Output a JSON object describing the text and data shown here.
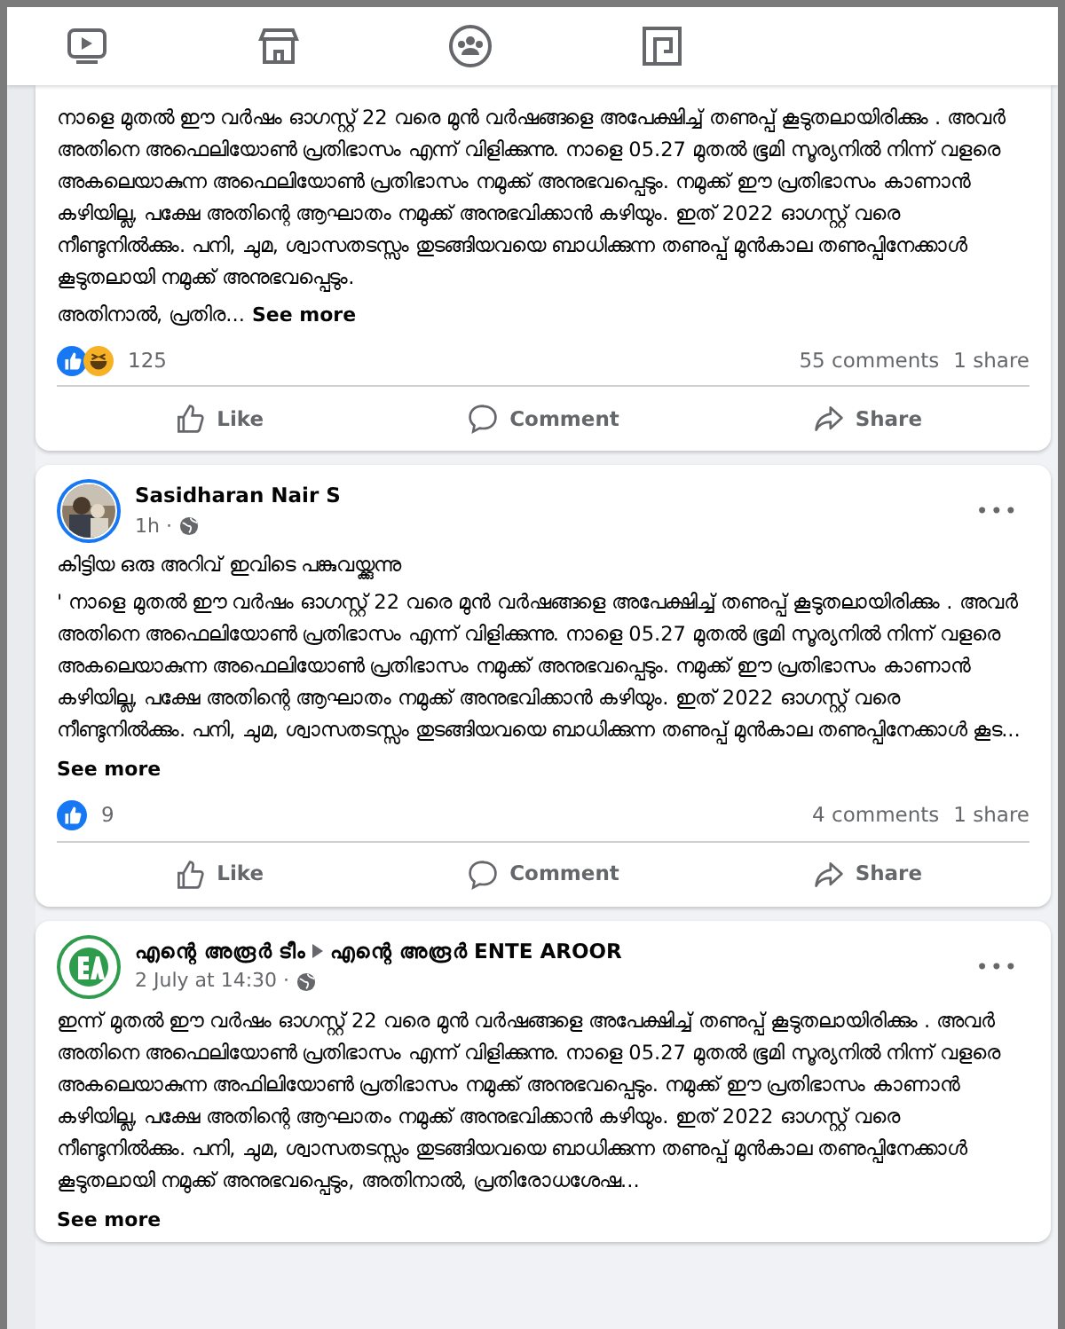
{
  "nav": [
    {
      "selected": false
    },
    {
      "selected": false
    },
    {
      "selected": false
    },
    {
      "selected": false
    }
  ],
  "posts": [
    {
      "paragraphs": [
        "നാളെ മുതൽ ഈ വർഷം ഓഗസ്റ്റ് 22 വരെ മുൻ വർഷങ്ങളെ അപേക്ഷിച്ച് തണുപ്പ് കൂടുതലായിരിക്കും .  അവർ അതിനെ അഫെലിയോൺ പ്രതിഭാസം എന്ന് വിളിക്കുന്നു.  നാളെ 05.27 മുതൽ ഭൂമി സൂര്യനിൽ നിന്ന് വളരെ അകലെയാകുന്ന അഫെലിയോൺ പ്രതിഭാസം നമുക്ക് അനുഭവപ്പെടും.  നമുക്ക് ഈ പ്രതിഭാസം കാണാൻ കഴിയില്ല, പക്ഷേ അതിന്റെ ആഘാതം നമുക്ക് അനുഭവിക്കാൻ കഴിയും. ഇത് 2022 ഓഗസ്റ്റ് വരെ നീണ്ടുനിൽക്കും.  പനി, ചുമ, ശ്വാസതടസ്സം തുടങ്ങിയവയെ ബാധിക്കുന്ന തണുപ്പ് മുൻകാല തണുപ്പിനേക്കാൾ കൂടുതലായി നമുക്ക് അനുഭവപ്പെടും.",
        "അതിനാൽ, പ്രതിര..."
      ],
      "see_more": "See more",
      "reactions": [
        {
          "kind": "like"
        },
        {
          "kind": "haha"
        }
      ],
      "reaction_count": "125",
      "comments": "55 comments",
      "shares": "1 share",
      "actions": [
        "Like",
        "Comment",
        "Share"
      ]
    },
    {
      "author": "Sasidharan Nair S",
      "time": "1h ·",
      "paragraphs": [
        "കിട്ടിയ ഒരു അറിവ് ഇവിടെ പങ്കുവയ്ക്കുന്നു",
        "'  നാളെ മുതൽ ഈ വർഷം ഓഗസ്റ്റ് 22 വരെ മുൻ വർഷങ്ങളെ അപേക്ഷിച്ച് തണുപ്പ് കൂടുതലായിരിക്കും .  അവർ അതിനെ അഫെലിയോൺ പ്രതിഭാസം എന്ന് വിളിക്കുന്നു.  നാളെ 05.27 മുതൽ ഭൂമി സൂര്യനിൽ നിന്ന് വളരെ അകലെയാകുന്ന അഫെലിയോൺ പ്രതിഭാസം നമുക്ക് അനുഭവപ്പെടും.  നമുക്ക് ഈ പ്രതിഭാസം കാണാൻ കഴിയില്ല, പക്ഷേ അതിന്റെ ആഘാതം നമുക്ക് അനുഭവിക്കാൻ കഴിയും. ഇത് 2022 ഓഗസ്റ്റ് വരെ നീണ്ടുനിൽക്കും.  പനി, ചുമ, ശ്വാസതടസ്സം തുടങ്ങിയവയെ ബാധിക്കുന്ന തണുപ്പ് മുൻകാല തണുപ്പിനേക്കാൾ കൂട..."
      ],
      "see_more": "See more",
      "reactions": [
        {
          "kind": "like"
        }
      ],
      "reaction_count": "9",
      "comments": "4 comments",
      "shares": "1 share",
      "actions": [
        "Like",
        "Comment",
        "Share"
      ],
      "menu": "•••"
    },
    {
      "author": "എന്റെ അരൂർ ടീം",
      "target": "എന്റെ അരൂർ ENTE AROOR",
      "time": "2 July at 14:30 ·",
      "paragraphs": [
        "ഇന്ന്  മുതൽ ഈ വർഷം ഓഗസ്റ്റ് 22 വരെ മുൻ വർഷങ്ങളെ അപേക്ഷിച്ച് തണുപ്പ് കൂടുതലായിരിക്കും . അവർ അതിനെ അഫെലിയോൺ പ്രതിഭാസം എന്ന് വിളിക്കുന്നു. നാളെ 05.27 മുതൽ ഭൂമി സൂര്യനിൽ നിന്ന് വളരെ അകലെയാകുന്ന അഫിലിയോൺ പ്രതിഭാസം നമുക്ക് അനുഭവപ്പെടും. നമുക്ക് ഈ പ്രതിഭാസം കാണാൻ കഴിയില്ല, പക്ഷേ അതിന്റെ ആഘാതം നമുക്ക് അനുഭവിക്കാൻ കഴിയും. ഇത് 2022 ഓഗസ്റ്റ് വരെ നീണ്ടുനിൽക്കും. പനി, ചുമ, ശ്വാസതടസ്സം തുടങ്ങിയവയെ ബാധിക്കുന്ന തണുപ്പ് മുൻകാല തണുപ്പിനേക്കാൾ കൂടുതലായി നമുക്ക് അനുഭവപ്പെടും, അതിനാൽ, പ്രതിരോധശേഷ..."
      ],
      "see_more": "See more",
      "menu": "•••"
    }
  ]
}
